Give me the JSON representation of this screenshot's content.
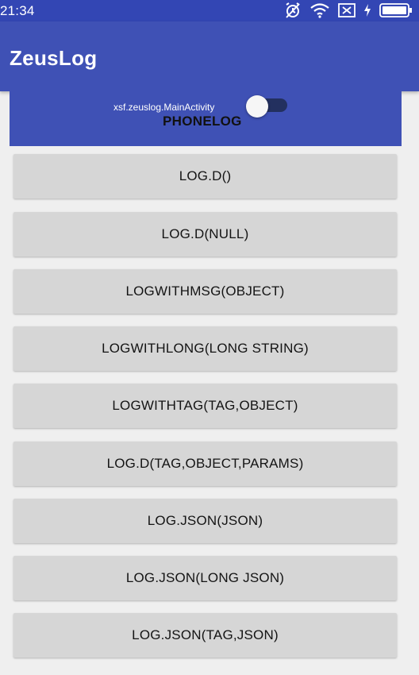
{
  "status_bar": {
    "time": "21:34",
    "icons": [
      "alarm-off-icon",
      "wifi-icon",
      "sim-icon",
      "charging-icon",
      "battery-icon"
    ]
  },
  "app_bar": {
    "title": "ZeusLog"
  },
  "phonelog_panel": {
    "activity_label": "xsf.zeuslog.MainActivity",
    "label": "PHONELOG",
    "switch_state": "on"
  },
  "buttons": [
    {
      "label": "LOG.D()"
    },
    {
      "label": "LOG.D(NULL)"
    },
    {
      "label": "LOGWITHMSG(OBJECT)"
    },
    {
      "label": "LOGWITHLONG(LONG STRING)"
    },
    {
      "label": "LOGWITHTAG(TAG,OBJECT)"
    },
    {
      "label": "LOG.D(TAG,OBJECT,PARAMS)"
    },
    {
      "label": "LOG.JSON(JSON)"
    },
    {
      "label": "LOG.JSON(LONG JSON)"
    },
    {
      "label": "LOG.JSON(TAG,JSON)"
    }
  ],
  "colors": {
    "primary": "#3f51b5",
    "primary_dark": "#3346b4",
    "button_bg": "#d6d6d6",
    "background": "#efefef"
  }
}
